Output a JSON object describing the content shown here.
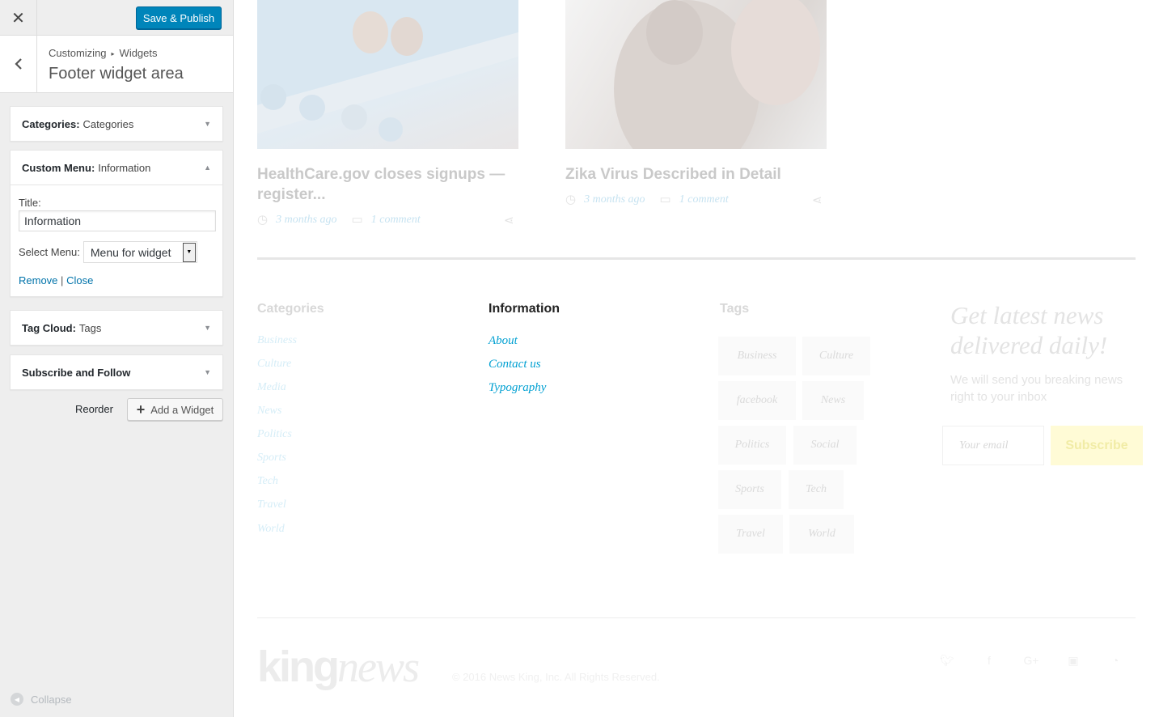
{
  "topbar": {
    "close_label": "✕",
    "publish_label": "Save & Publish"
  },
  "section": {
    "breadcrumb_root": "Customizing",
    "breadcrumb_sep": "▸",
    "breadcrumb_leaf": "Widgets",
    "title": "Footer widget area"
  },
  "widgets": [
    {
      "type": "Categories:",
      "name": "Categories",
      "state": "collapsed"
    },
    {
      "type": "Custom Menu:",
      "name": "Information",
      "state": "expanded"
    },
    {
      "type": "Tag Cloud:",
      "name": "Tags",
      "state": "collapsed"
    },
    {
      "type": "Subscribe and Follow",
      "name": "",
      "state": "collapsed"
    }
  ],
  "custom_menu_form": {
    "title_label": "Title:",
    "title_value": "Information",
    "select_label": "Select Menu:",
    "select_value": "Menu for widget",
    "remove_label": "Remove",
    "link_sep": "|",
    "close_label": "Close"
  },
  "actions": {
    "reorder_label": "Reorder",
    "add_widget_label": "Add a Widget",
    "collapse_label": "Collapse"
  },
  "preview": {
    "posts": [
      {
        "title": "HealthCare.gov closes signups — register...",
        "time": "3 months ago",
        "comments": "1 comment"
      },
      {
        "title": "Zika Virus Described in Detail",
        "time": "3 months ago",
        "comments": "1 comment"
      }
    ],
    "footer": {
      "categories_title": "Categories",
      "categories": [
        "Business",
        "Culture",
        "Media",
        "News",
        "Politics",
        "Sports",
        "Tech",
        "Travel",
        "World"
      ],
      "info_title": "Information",
      "info_links": [
        "About",
        "Contact us",
        "Typography"
      ],
      "tags_title": "Tags",
      "tags": [
        "Business",
        "Culture",
        "facebook",
        "News",
        "Politics",
        "Social",
        "Sports",
        "Tech",
        "Travel",
        "World"
      ],
      "newsletter_heading": "Get latest news delivered daily!",
      "newsletter_sub": "We will send you breaking news right to your inbox",
      "email_placeholder": "Your email",
      "subscribe_label": "Subscribe",
      "logo_a": "king",
      "logo_b": "news",
      "copyright": "© 2016 News King, Inc. All Rights Reserved."
    }
  },
  "colors": {
    "accent": "#0085ba",
    "link": "#0073aa",
    "info_link": "#00a0d2"
  }
}
